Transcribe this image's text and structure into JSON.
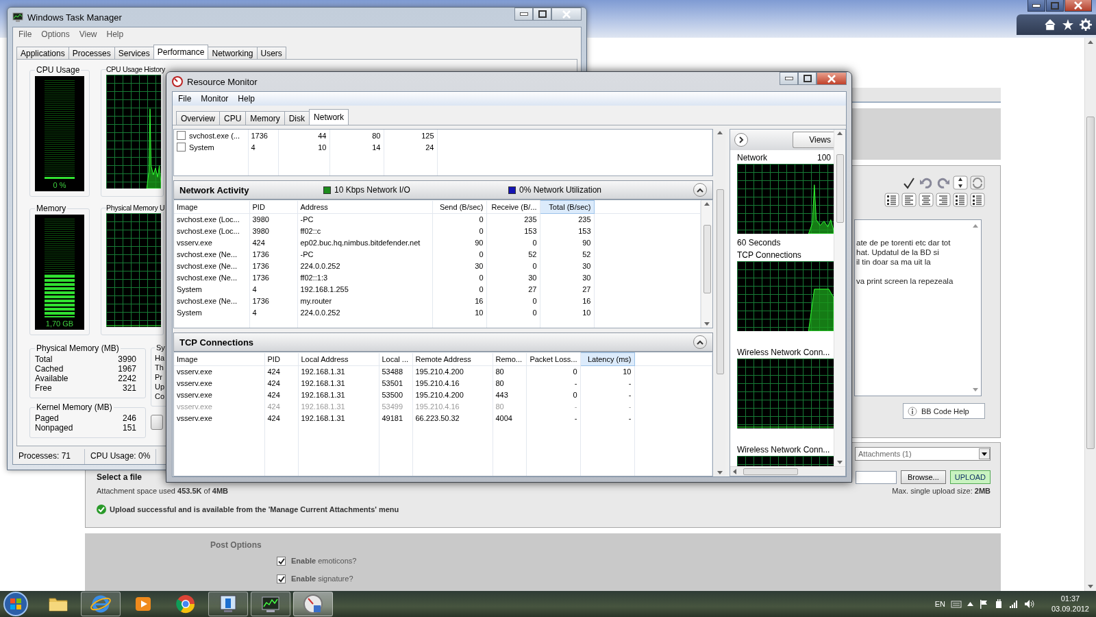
{
  "browser": {
    "editor_paragraphs": [
      [
        "ate de pe torenti etc dar tot",
        "hat. Updatul de la BD si",
        "il tin doar sa ma uit la"
      ],
      [
        "va print screen la repezeala"
      ]
    ],
    "bb_code_help": "BB Code Help",
    "attachments_select": "Attachments (1)",
    "select_file": "Select a file",
    "browse_button": "Browse...",
    "upload_button": "UPLOAD",
    "space_used": "Attachment space used **453.5K** of **4MB**",
    "max_upload": "Max. single upload size: **2MB**",
    "upload_message": "Upload successful and is available from the 'Manage Current Attachments' menu",
    "post_options_title": "Post Options",
    "options": [
      {
        "label": "**Enable** emoticons?",
        "checked": true
      },
      {
        "label": "**Enable** signature?",
        "checked": true
      }
    ]
  },
  "task_manager": {
    "title": "Windows Task Manager",
    "menu": [
      "File",
      "Options",
      "View",
      "Help"
    ],
    "tabs": [
      {
        "label": "Applications",
        "selected": false
      },
      {
        "label": "Processes",
        "selected": false
      },
      {
        "label": "Services",
        "selected": false
      },
      {
        "label": "Performance",
        "selected": true
      },
      {
        "label": "Networking",
        "selected": false
      },
      {
        "label": "Users",
        "selected": false
      }
    ],
    "cpu_usage": {
      "title": "CPU Usage",
      "reading": "0 %",
      "level": 0
    },
    "cpu_history": {
      "title": "CPU Usage History",
      "kind": "spike"
    },
    "memory": {
      "title": "Memory",
      "reading": "1,70 GB",
      "level": 0.43
    },
    "memory_history": {
      "title": "Physical Memory U",
      "kind": "flat"
    },
    "physical_memory": {
      "title": "Physical Memory (MB)",
      "rows": [
        {
          "label": "Total",
          "value": "3990"
        },
        {
          "label": "Cached",
          "value": "1967"
        },
        {
          "label": "Available",
          "value": "2242"
        },
        {
          "label": "Free",
          "value": "321"
        }
      ]
    },
    "kernel_memory": {
      "title": "Kernel Memory (MB)",
      "rows": [
        {
          "label": "Paged",
          "value": "246"
        },
        {
          "label": "Nonpaged",
          "value": "151"
        }
      ]
    },
    "system": {
      "title": "Sy",
      "labels": [
        "Ha",
        "Th",
        "Pr",
        "Up",
        "Co"
      ]
    },
    "status_bar": [
      "Processes: 71",
      "CPU Usage: 0%"
    ]
  },
  "resource_monitor": {
    "title": "Resource Monitor",
    "menu": [
      "File",
      "Monitor",
      "Help"
    ],
    "tabs": [
      {
        "label": "Overview",
        "selected": false
      },
      {
        "label": "CPU",
        "selected": false
      },
      {
        "label": "Memory",
        "selected": false
      },
      {
        "label": "Disk",
        "selected": false
      },
      {
        "label": "Network",
        "selected": true
      }
    ],
    "processes": [
      {
        "checked": false,
        "cells": [
          "svchost.exe (...",
          "1736",
          "44",
          "80",
          "125"
        ]
      },
      {
        "checked": false,
        "cells": [
          "System",
          "4",
          "10",
          "14",
          "24"
        ]
      }
    ],
    "network_activity": {
      "title": "Network Activity",
      "expanded": true,
      "legend": [
        {
          "label": "10 Kbps Network I/O",
          "color": "#1e8c1e"
        },
        {
          "label": "0% Network Utilization",
          "color": "#1414b4"
        }
      ],
      "columns": [
        {
          "label": "Image",
          "sorted": false
        },
        {
          "label": "PID",
          "sorted": false
        },
        {
          "label": "Address",
          "sorted": false
        },
        {
          "label": "Send (B/sec)",
          "sorted": false
        },
        {
          "label": "Receive (B/...",
          "sorted": false
        },
        {
          "label": "Total (B/sec)",
          "sorted": true
        }
      ],
      "rows": [
        [
          "svchost.exe (Loc...",
          "3980",
          "-PC",
          "0",
          "235",
          "235"
        ],
        [
          "svchost.exe (Loc...",
          "3980",
          "ff02::c",
          "0",
          "153",
          "153"
        ],
        [
          "vsserv.exe",
          "424",
          "ep02.buc.hq.nimbus.bitdefender.net",
          "90",
          "0",
          "90"
        ],
        [
          "svchost.exe (Ne...",
          "1736",
          "-PC",
          "0",
          "52",
          "52"
        ],
        [
          "svchost.exe (Ne...",
          "1736",
          "224.0.0.252",
          "30",
          "0",
          "30"
        ],
        [
          "svchost.exe (Ne...",
          "1736",
          "ff02::1:3",
          "0",
          "30",
          "30"
        ],
        [
          "System",
          "4",
          "192.168.1.255",
          "0",
          "27",
          "27"
        ],
        [
          "svchost.exe (Ne...",
          "1736",
          "my.router",
          "16",
          "0",
          "16"
        ],
        [
          "System",
          "4",
          "224.0.0.252",
          "10",
          "0",
          "10"
        ]
      ]
    },
    "tcp_connections": {
      "title": "TCP Connections",
      "expanded": true,
      "columns": [
        {
          "label": "Image",
          "sorted": false
        },
        {
          "label": "PID",
          "sorted": false
        },
        {
          "label": "Local Address",
          "sorted": false
        },
        {
          "label": "Local ...",
          "sorted": false
        },
        {
          "label": "Remote Address",
          "sorted": false
        },
        {
          "label": "Remo...",
          "sorted": false
        },
        {
          "label": "Packet Loss...",
          "sorted": false
        },
        {
          "label": "Latency (ms)",
          "sorted": true
        }
      ],
      "rows": [
        {
          "disabled": false,
          "cells": [
            "vsserv.exe",
            "424",
            "192.168.1.31",
            "53488",
            "195.210.4.200",
            "80",
            "0",
            "10"
          ]
        },
        {
          "disabled": false,
          "cells": [
            "vsserv.exe",
            "424",
            "192.168.1.31",
            "53501",
            "195.210.4.16",
            "80",
            "-",
            "-"
          ]
        },
        {
          "disabled": false,
          "cells": [
            "vsserv.exe",
            "424",
            "192.168.1.31",
            "53500",
            "195.210.4.200",
            "443",
            "0",
            "-"
          ]
        },
        {
          "disabled": true,
          "cells": [
            "vsserv.exe",
            "424",
            "192.168.1.31",
            "53499",
            "195.210.4.16",
            "80",
            "-",
            "-"
          ]
        },
        {
          "disabled": false,
          "cells": [
            "vsserv.exe",
            "424",
            "192.168.1.31",
            "49181",
            "66.223.50.32",
            "4004",
            "-",
            "-"
          ]
        }
      ]
    },
    "side_panel": {
      "views_button": "Views",
      "graphs": [
        {
          "title": "Network",
          "value": "100",
          "caption": "60 Seconds",
          "kind": "spike"
        },
        {
          "title": "TCP Connections",
          "kind": "plateau"
        },
        {
          "title": "Wireless Network Conn...",
          "kind": "flat"
        },
        {
          "title": "Wireless Network Conn...",
          "kind": "flat"
        }
      ]
    }
  },
  "taskbar": {
    "buttons": [
      {
        "kind": "folder",
        "running": false,
        "selected": false
      },
      {
        "kind": "browser",
        "running": true,
        "selected": false
      },
      {
        "kind": "player",
        "running": false,
        "selected": false
      },
      {
        "kind": "round-logo",
        "running": false,
        "selected": false
      },
      {
        "kind": "monitor",
        "running": true,
        "selected": false
      },
      {
        "kind": "chart-monitor",
        "running": true,
        "selected": false
      },
      {
        "kind": "gauge",
        "running": true,
        "selected": true
      }
    ],
    "language": "EN",
    "time": "01:37",
    "date": "03.09.2012"
  }
}
